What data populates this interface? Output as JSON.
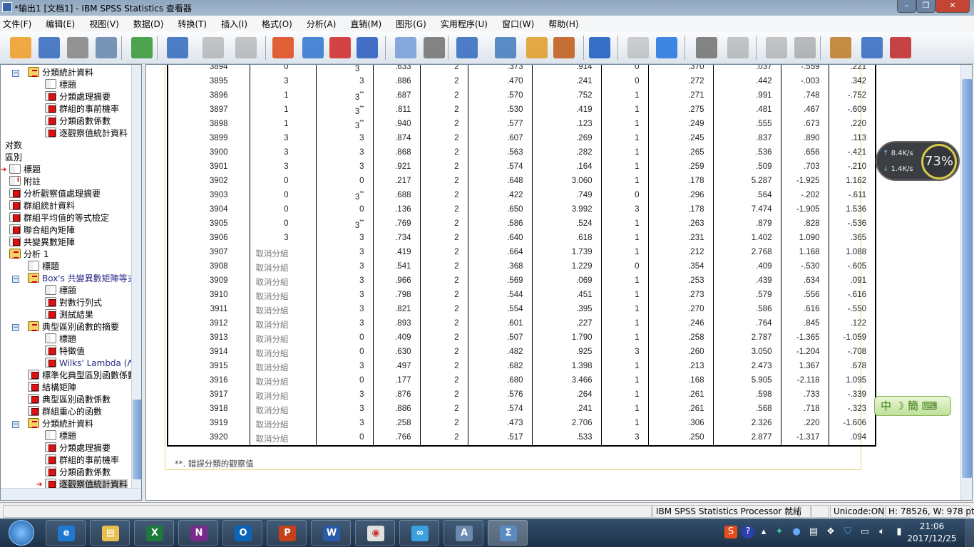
{
  "window": {
    "title": "*输出1 [文档1] - IBM SPSS Statistics 查看器"
  },
  "menu": [
    "文件(F)",
    "编辑(E)",
    "视图(V)",
    "数据(D)",
    "转换(T)",
    "插入(I)",
    "格式(O)",
    "分析(A)",
    "直销(M)",
    "图形(G)",
    "实用程序(U)",
    "窗口(W)",
    "帮助(H)"
  ],
  "toolbar": {
    "icons": [
      "open-icon",
      "save-icon",
      "print-icon",
      "print-preview-icon",
      "export-icon",
      "recall-dialog-icon",
      "undo-icon",
      "redo-icon",
      "goto-data-icon",
      "goto-case-icon",
      "goto-variable-icon",
      "variables-icon",
      "use-sets-icon",
      "show-all-variables-icon",
      "spell-check-icon",
      "select-outputs-icon",
      "designate-window-icon",
      "insert-text-icon",
      "run-script-icon",
      "fullscreen-icon",
      "back-icon",
      "forward-icon",
      "expand-icon",
      "collapse-icon",
      "show-icon",
      "hide-icon",
      "insert-heading-icon",
      "insert-title-icon",
      "insert-new-text-icon"
    ]
  },
  "outline": [
    {
      "level": 2,
      "type": "book",
      "label": "分類統計資料",
      "collapse": true
    },
    {
      "level": 3,
      "type": "title",
      "label": "標題"
    },
    {
      "level": 3,
      "type": "tbl",
      "label": "分類處理摘要"
    },
    {
      "level": 3,
      "type": "tbl",
      "label": "群組的事前機率"
    },
    {
      "level": 3,
      "type": "tbl",
      "label": "分類函數係數"
    },
    {
      "level": 3,
      "type": "tbl",
      "label": "逐觀察值統計資料"
    },
    {
      "level": 0,
      "type": "text",
      "label": "对数"
    },
    {
      "level": 0,
      "type": "text",
      "label": "區別"
    },
    {
      "level": 1,
      "type": "title",
      "label": "標題",
      "arrow": true
    },
    {
      "level": 1,
      "type": "note",
      "label": "附註"
    },
    {
      "level": 1,
      "type": "tbl",
      "label": "分析觀察值處理摘要"
    },
    {
      "level": 1,
      "type": "tbl",
      "label": "群組統計資料"
    },
    {
      "level": 1,
      "type": "tbl",
      "label": "群組平均值的等式檢定"
    },
    {
      "level": 1,
      "type": "tbl",
      "label": "聯合組內矩陣"
    },
    {
      "level": 1,
      "type": "tbl",
      "label": "共變異數矩陣"
    },
    {
      "level": 1,
      "type": "book",
      "label": "分析 1"
    },
    {
      "level": 2,
      "type": "title",
      "label": "標題"
    },
    {
      "level": 2,
      "type": "book",
      "label": "Box's 共變異數矩陣等式",
      "collapse": true
    },
    {
      "level": 3,
      "type": "title",
      "label": "標題"
    },
    {
      "level": 3,
      "type": "tbl",
      "label": "對數行列式"
    },
    {
      "level": 3,
      "type": "tbl",
      "label": "測試結果"
    },
    {
      "level": 2,
      "type": "book",
      "label": "典型區別函數的摘要",
      "collapse": true
    },
    {
      "level": 3,
      "type": "title",
      "label": "標題"
    },
    {
      "level": 3,
      "type": "tbl",
      "label": "特徵值"
    },
    {
      "level": 3,
      "type": "tbl",
      "label": "Wilks' Lambda (Λ)"
    },
    {
      "level": 2,
      "type": "tbl",
      "label": "標準化典型區別函數係數"
    },
    {
      "level": 2,
      "type": "tbl",
      "label": "結構矩陣"
    },
    {
      "level": 2,
      "type": "tbl",
      "label": "典型區別函數係數"
    },
    {
      "level": 2,
      "type": "tbl",
      "label": "群組重心的函數"
    },
    {
      "level": 2,
      "type": "book",
      "label": "分類統計資料",
      "collapse": true
    },
    {
      "level": 3,
      "type": "title",
      "label": "標題"
    },
    {
      "level": 3,
      "type": "tbl",
      "label": "分類處理摘要"
    },
    {
      "level": 3,
      "type": "tbl",
      "label": "群組的事前機率"
    },
    {
      "level": 3,
      "type": "tbl",
      "label": "分類函數係數"
    },
    {
      "level": 3,
      "type": "tbl",
      "label": "逐觀察值統計資料",
      "selected": true,
      "arrow": true
    }
  ],
  "table": {
    "misclassified_mark": "**",
    "rows": [
      [
        "3894",
        "0",
        "3**",
        ".633",
        "2",
        ".373",
        ".914",
        "0",
        ".370",
        ".037",
        "-.559",
        ".221"
      ],
      [
        "3895",
        "3",
        "3",
        ".886",
        "2",
        ".470",
        ".241",
        "0",
        ".272",
        ".442",
        "-.003",
        ".342"
      ],
      [
        "3896",
        "1",
        "3**",
        ".687",
        "2",
        ".570",
        ".752",
        "1",
        ".271",
        ".991",
        ".748",
        "-.752"
      ],
      [
        "3897",
        "1",
        "3**",
        ".811",
        "2",
        ".530",
        ".419",
        "1",
        ".275",
        ".481",
        ".467",
        "-.609"
      ],
      [
        "3898",
        "1",
        "3**",
        ".940",
        "2",
        ".577",
        ".123",
        "1",
        ".249",
        ".555",
        ".673",
        ".220"
      ],
      [
        "3899",
        "3",
        "3",
        ".874",
        "2",
        ".607",
        ".269",
        "1",
        ".245",
        ".837",
        ".890",
        ".113"
      ],
      [
        "3900",
        "3",
        "3",
        ".868",
        "2",
        ".563",
        ".282",
        "1",
        ".265",
        ".536",
        ".656",
        "-.421"
      ],
      [
        "3901",
        "3",
        "3",
        ".921",
        "2",
        ".574",
        ".164",
        "1",
        ".259",
        ".509",
        ".703",
        "-.210"
      ],
      [
        "3902",
        "0",
        "0",
        ".217",
        "2",
        ".648",
        "3.060",
        "1",
        ".178",
        "5.287",
        "-1.925",
        "1.162"
      ],
      [
        "3903",
        "0",
        "3**",
        ".688",
        "2",
        ".422",
        ".749",
        "0",
        ".296",
        ".564",
        "-.202",
        "-.611"
      ],
      [
        "3904",
        "0",
        "0",
        ".136",
        "2",
        ".650",
        "3.992",
        "3",
        ".178",
        "7.474",
        "-1.905",
        "1.536"
      ],
      [
        "3905",
        "0",
        "3**",
        ".769",
        "2",
        ".586",
        ".524",
        "1",
        ".263",
        ".879",
        ".828",
        "-.536"
      ],
      [
        "3906",
        "3",
        "3",
        ".734",
        "2",
        ".640",
        ".618",
        "1",
        ".231",
        "1.402",
        "1.090",
        ".365"
      ],
      [
        "3907",
        "取消分組",
        "3",
        ".419",
        "2",
        ".664",
        "1.739",
        "1",
        ".212",
        "2.768",
        "1.168",
        "1.088"
      ],
      [
        "3908",
        "取消分組",
        "3",
        ".541",
        "2",
        ".368",
        "1.229",
        "0",
        ".354",
        ".409",
        "-.530",
        "-.605"
      ],
      [
        "3909",
        "取消分組",
        "3",
        ".966",
        "2",
        ".569",
        ".069",
        "1",
        ".253",
        ".439",
        ".634",
        ".091"
      ],
      [
        "3910",
        "取消分組",
        "3",
        ".798",
        "2",
        ".544",
        ".451",
        "1",
        ".273",
        ".579",
        ".556",
        "-.616"
      ],
      [
        "3911",
        "取消分組",
        "3",
        ".821",
        "2",
        ".554",
        ".395",
        "1",
        ".270",
        ".586",
        ".616",
        "-.550"
      ],
      [
        "3912",
        "取消分組",
        "3",
        ".893",
        "2",
        ".601",
        ".227",
        "1",
        ".246",
        ".764",
        ".845",
        ".122"
      ],
      [
        "3913",
        "取消分組",
        "0",
        ".409",
        "2",
        ".507",
        "1.790",
        "1",
        ".258",
        "2.787",
        "-1.365",
        "-1.059"
      ],
      [
        "3914",
        "取消分組",
        "0",
        ".630",
        "2",
        ".482",
        ".925",
        "3",
        ".260",
        "3.050",
        "-1.204",
        "-.708"
      ],
      [
        "3915",
        "取消分組",
        "3",
        ".497",
        "2",
        ".682",
        "1.398",
        "1",
        ".213",
        "2.473",
        "1.367",
        ".678"
      ],
      [
        "3916",
        "取消分組",
        "0",
        ".177",
        "2",
        ".680",
        "3.466",
        "1",
        ".168",
        "5.905",
        "-2.118",
        "1.095"
      ],
      [
        "3917",
        "取消分組",
        "3",
        ".876",
        "2",
        ".576",
        ".264",
        "1",
        ".261",
        ".598",
        ".733",
        "-.339"
      ],
      [
        "3918",
        "取消分組",
        "3",
        ".886",
        "2",
        ".574",
        ".241",
        "1",
        ".261",
        ".568",
        ".718",
        "-.323"
      ],
      [
        "3919",
        "取消分組",
        "3",
        ".258",
        "2",
        ".473",
        "2.706",
        "1",
        ".306",
        "2.326",
        ".220",
        "-1.606"
      ],
      [
        "3920",
        "取消分組",
        "0",
        ".766",
        "2",
        ".517",
        ".533",
        "3",
        ".250",
        "2.877",
        "-1.317",
        ".094"
      ]
    ],
    "footnote": "**. 錯誤分類的觀察值"
  },
  "status": {
    "processor": "IBM SPSS Statistics Processor 就绪",
    "unicode": "Unicode:ON",
    "size": "H: 78526, W: 978 pt."
  },
  "netwidget": {
    "up": "8.4K/s",
    "down": "1.4K/s",
    "percent": "73%"
  },
  "ime": {
    "label": "中",
    "mode": "簡"
  },
  "taskbar": {
    "apps": [
      "ie-icon",
      "file-explorer-icon",
      "excel-icon",
      "onenote-icon",
      "outlook-icon",
      "powerpoint-icon",
      "word-icon",
      "chrome-icon",
      "baidu-netdisk-icon",
      "writer-icon",
      "spss-icon"
    ],
    "time": "21:06",
    "date": "2017/12/25"
  }
}
